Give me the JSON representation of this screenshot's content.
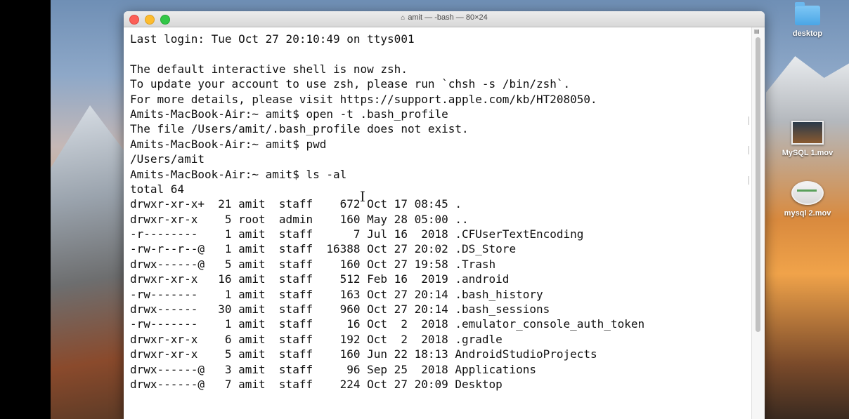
{
  "window": {
    "title": "amit — -bash — 80×24"
  },
  "terminal": {
    "lines": [
      "Last login: Tue Oct 27 20:10:49 on ttys001",
      "",
      "The default interactive shell is now zsh.",
      "To update your account to use zsh, please run `chsh -s /bin/zsh`.",
      "For more details, please visit https://support.apple.com/kb/HT208050.",
      "Amits-MacBook-Air:~ amit$ open -t .bash_profile",
      "The file /Users/amit/.bash_profile does not exist.",
      "Amits-MacBook-Air:~ amit$ pwd",
      "/Users/amit",
      "Amits-MacBook-Air:~ amit$ ls -al",
      "total 64",
      "drwxr-xr-x+  21 amit  staff    672 Oct 17 08:45 .",
      "drwxr-xr-x    5 root  admin    160 May 28 05:00 ..",
      "-r--------    1 amit  staff      7 Jul 16  2018 .CFUserTextEncoding",
      "-rw-r--r--@   1 amit  staff  16388 Oct 27 20:02 .DS_Store",
      "drwx------@   5 amit  staff    160 Oct 27 19:58 .Trash",
      "drwxr-xr-x   16 amit  staff    512 Feb 16  2019 .android",
      "-rw-------    1 amit  staff    163 Oct 27 20:14 .bash_history",
      "drwx------   30 amit  staff    960 Oct 27 20:14 .bash_sessions",
      "-rw-------    1 amit  staff     16 Oct  2  2018 .emulator_console_auth_token",
      "drwxr-xr-x    6 amit  staff    192 Oct  2  2018 .gradle",
      "drwxr-xr-x    5 amit  staff    160 Jun 22 18:13 AndroidStudioProjects",
      "drwx------@   3 amit  staff     96 Sep 25  2018 Applications",
      "drwx------@   7 amit  staff    224 Oct 27 20:09 Desktop"
    ]
  },
  "desktop_icons": [
    {
      "label": "desktop",
      "icon": "folder-icon"
    },
    {
      "label": "MySQL 1.mov",
      "icon": "video-file-icon"
    },
    {
      "label": "mysql 2.mov",
      "icon": "video-file-icon"
    }
  ],
  "colors": {
    "close": "#fc5f57",
    "minimize": "#fdbc2e",
    "zoom": "#33c748"
  }
}
